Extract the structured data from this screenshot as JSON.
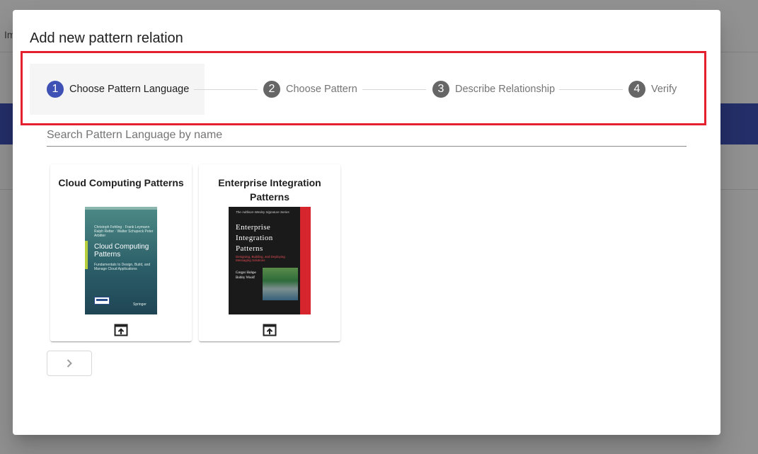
{
  "background": {
    "toolbar_text": "Im"
  },
  "dialog": {
    "title": "Add new pattern relation",
    "steps": [
      {
        "number": "1",
        "label": "Choose Pattern Language",
        "active": true
      },
      {
        "number": "2",
        "label": "Choose Pattern",
        "active": false
      },
      {
        "number": "3",
        "label": "Describe Relationship",
        "active": false
      },
      {
        "number": "4",
        "label": "Verify",
        "active": false
      }
    ],
    "search": {
      "placeholder": "Search Pattern Language by name",
      "value": ""
    },
    "cards": [
      {
        "title": "Cloud Computing Patterns",
        "cover": {
          "authors": "Christoph Fehling · Frank Leymann Ralph Retter · Walter Schupeck Peter Arbitter",
          "title": "Cloud Computing Patterns",
          "subtitle": "Fundamentals to Design, Build, and Manage Cloud Applications",
          "publisher": "Springer"
        },
        "action_icon": "open-in-new-icon"
      },
      {
        "title": "Enterprise Integration Patterns",
        "cover": {
          "series": "The Addison-Wesley Signature Series",
          "title_line1": "Enterprise",
          "title_line2": "Integration",
          "title_line3": "Patterns",
          "subtitle": "Designing, Building, and Deploying Messaging Solutions",
          "author1": "Gregor Hohpe",
          "author2": "Bobby Woolf"
        },
        "action_icon": "open-in-new-icon"
      }
    ],
    "next_button_icon": "chevron-right-icon"
  },
  "colors": {
    "primary": "#3f51b5",
    "highlight": "#e5202e",
    "inactive_step": "#666666"
  }
}
